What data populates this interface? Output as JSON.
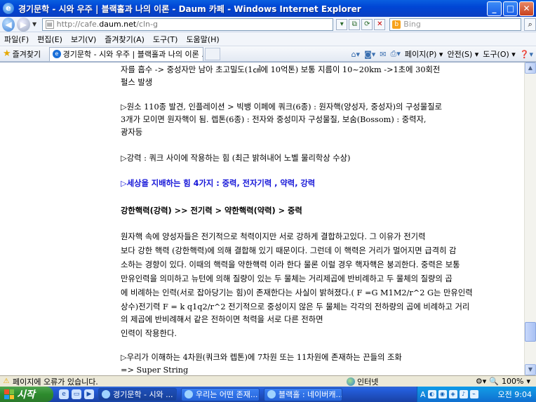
{
  "window": {
    "title": "경기문학 - 시와 우주 | 블랙홀과 나의 이론 - Daum 카페 - Windows Internet Explorer",
    "app_icon": "e",
    "minimize": "_",
    "maximize": "□",
    "close": "✕"
  },
  "address": {
    "url_prefix": "http://cafe.",
    "url_domain": "daum.net",
    "url_suffix": "/cln-g",
    "search_placeholder": "Bing"
  },
  "menu": [
    "파일(F)",
    "편집(E)",
    "보기(V)",
    "즐겨찾기(A)",
    "도구(T)",
    "도움말(H)"
  ],
  "favorites": {
    "label": "즐겨찾기",
    "tab_label": "경기문학 - 시와 우주 | 블랙홀과 나의 이론 ...",
    "commands": [
      "페이지(P) ▾",
      "안전(S) ▾",
      "도구(O) ▾"
    ]
  },
  "document": {
    "lines": [
      "자를  흡수 -> 중성자만 남아 초고밀도(1㎤에 10억톤) 보통 지름이 10~20km ->1초에 30회전",
      "펄스  발생",
      "▷원소 110종 발견, 인플레이션 > 빅뱅 이페에 쿼크(6종) : 원자핵(양성자, 중성자)의 구성물질로",
      "  3개가 모이면 원자핵이 됨. 렙톤(6종) : 전자와 중성미자 구성물질,     보숨(Bossom) : 중력자,",
      "  광자등",
      "▷강력 : 쿼크 사이에 작용하는 힘 (최근 밝혀내어 노벨 물리학상 수상)",
      "▷세상을 지배하는 힘 4가지 : 중력, 전자기력 , 약력, 강력",
      " 강한핵력(강력) >> 전기력 > 약한핵력(약력) > 중력",
      "  원자핵 속에 양성자들은 전기적으로 척력이지만 서로 강하게 결합하고있다. 그 이유가 전기력",
      "보다   강한 핵력 (강한핵력)에 의해 결합해 있기 때문이다. 그런데 이 핵력은 거리가 멀어지면 급격히 감",
      "소하는 경향이 있다. 이때의 핵력을 약한핵력 이라 한다 물론 이럴 경우 핵자핵은 붕괴한다. 중력은 보통",
      "만유인력을 의미하고 뉴턴에 의해 질량이 있는 두 물체는 거리제곱에 반비례하고 두 물체의 질량의 곱",
      "에  비례하는 인력(서로 잡아당기는 힘)이 존재한다는 사실이 밝혀졌다.( F =G M1M2/r^2  G는 만유인력",
      "상수)전기력 F = k q1q2/r^2  전기적으로 중성이지 않은 두 물체는 각각의 전하량의 곱에 비례하고 거리",
      "의 제곱에 반비례해서 같은 전하이면 척력을  서로 다른 전하면",
      "인력이 작용한다.",
      "▷우리가 이해하는 4차원(쿼크와 렙톤)에 7차원 또는 11차원에 존재하는 끈들의 조화",
      "    => Super String"
    ]
  },
  "status": {
    "message": "페이지에 오류가 있습니다.",
    "zone": "인터넷",
    "zoom": "100%"
  },
  "taskbar": {
    "start": "시작",
    "tasks": [
      "경기문학 - 시와 ...",
      "우리는 어떤 존재...",
      "블랙홀 : 네이버캐..."
    ],
    "tray_lang": "A",
    "clock": "오전 9:04"
  }
}
